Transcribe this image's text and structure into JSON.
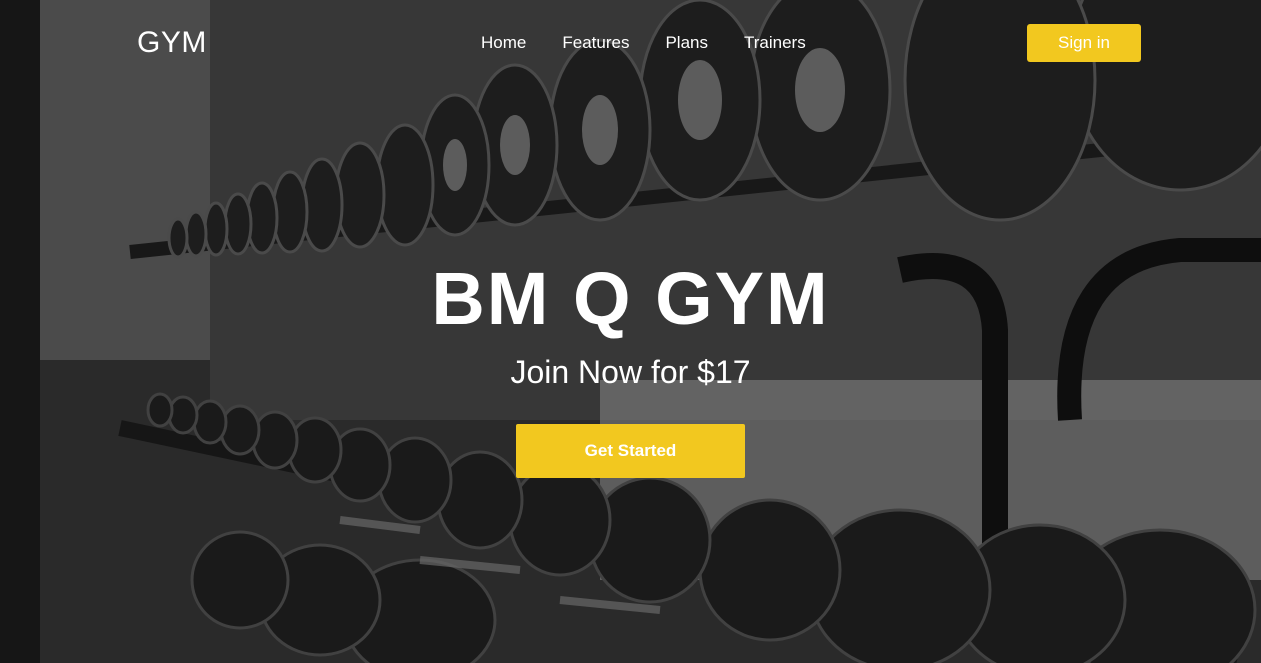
{
  "nav": {
    "brand": "GYM",
    "items": [
      {
        "label": "Home"
      },
      {
        "label": "Features"
      },
      {
        "label": "Plans"
      },
      {
        "label": "Trainers"
      }
    ],
    "signin_label": "Sign in"
  },
  "hero": {
    "title": "BM Q GYM",
    "subtitle": "Join Now for $17",
    "cta_label": "Get Started",
    "background_image": "grayscale-dumbbell-rack-photo"
  },
  "colors": {
    "accent": "#f2c81f",
    "text": "#ffffff"
  }
}
